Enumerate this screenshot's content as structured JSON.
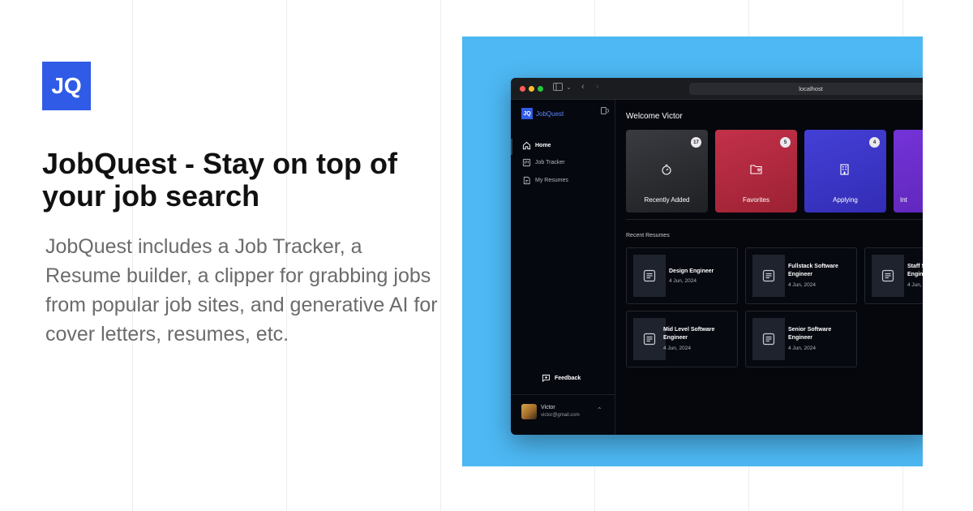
{
  "hero": {
    "logo_text": "JQ",
    "headline": "JobQuest - Stay on top of your job search",
    "description": "JobQuest includes a Job Tracker, a Resume builder, a clipper for grabbing jobs from popular job sites, and generative AI for cover letters, resumes, etc."
  },
  "browser": {
    "url": "localhost"
  },
  "app": {
    "brand_mark": "JQ",
    "brand_name": "JobQuest",
    "nav": [
      {
        "label": "Home",
        "icon": "home-icon",
        "active": true
      },
      {
        "label": "Job Tracker",
        "icon": "kanban-icon",
        "active": false
      },
      {
        "label": "My Resumes",
        "icon": "resume-icon",
        "active": false
      }
    ],
    "feedback_label": "Feedback",
    "user": {
      "name": "Victor",
      "email": "victor@gmail.com"
    },
    "welcome": "Welcome Victor",
    "cards": [
      {
        "label": "Recently Added",
        "count": "17",
        "icon": "timer-icon",
        "color": "#2b2c30"
      },
      {
        "label": "Favorites",
        "count": "5",
        "icon": "folder-heart-icon",
        "color": "#b3283c"
      },
      {
        "label": "Applying",
        "count": "4",
        "icon": "building-icon",
        "color": "#3c36c8"
      },
      {
        "label": "Int",
        "count": "",
        "icon": "",
        "color": "#6a2fd0"
      }
    ],
    "recent_resumes_title": "Recent Resumes",
    "resumes": [
      {
        "title": "Design Engineer",
        "date": "4 Jun, 2024"
      },
      {
        "title": "Fullstack Software Engineer",
        "date": "4 Jun, 2024"
      },
      {
        "title": "Staff S Engine",
        "date": "4 Jun,"
      },
      {
        "title": "Mid Level Software Engineer",
        "date": "4 Jun, 2024"
      },
      {
        "title": "Senior Software Engineer",
        "date": "4 Jun, 2024"
      }
    ]
  },
  "colors": {
    "accent": "#2f5be6",
    "stage_bg": "#4db8f3"
  }
}
